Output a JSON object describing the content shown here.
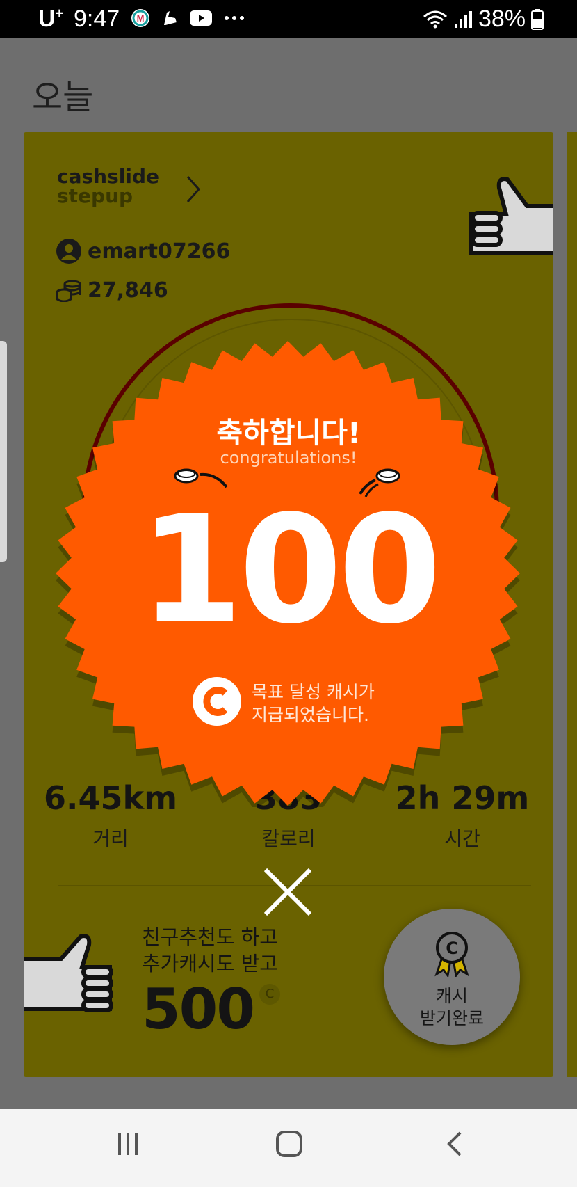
{
  "status_bar": {
    "carrier": "U",
    "carrier_sup": "+",
    "time": "9:47",
    "battery": "38%"
  },
  "header": {
    "title": "오늘"
  },
  "card": {
    "logo_line1": "cashslide",
    "logo_line2": "stepup",
    "username": "emart07266",
    "points": "27,846",
    "stats": [
      {
        "value": "6.45km",
        "label": "거리"
      },
      {
        "value": "383",
        "label": "칼로리"
      },
      {
        "value": "2h 29m",
        "label": "시간"
      }
    ],
    "referral": {
      "line1": "친구추천도 하고",
      "line2": "추가캐시도 받고",
      "amount": "500",
      "coin": "C"
    },
    "claim_button": {
      "line1": "캐시",
      "line2": "받기완료"
    }
  },
  "popup": {
    "title": "축하합니다!",
    "subtitle": "congratulations!",
    "amount": "100",
    "message_line1": "목표 달성 캐시가",
    "message_line2": "지급되었습니다.",
    "badge_color": "#ff5a00"
  },
  "colors": {
    "card_bg": "#6a6200",
    "overlay_bg": "#6e6e6e"
  }
}
